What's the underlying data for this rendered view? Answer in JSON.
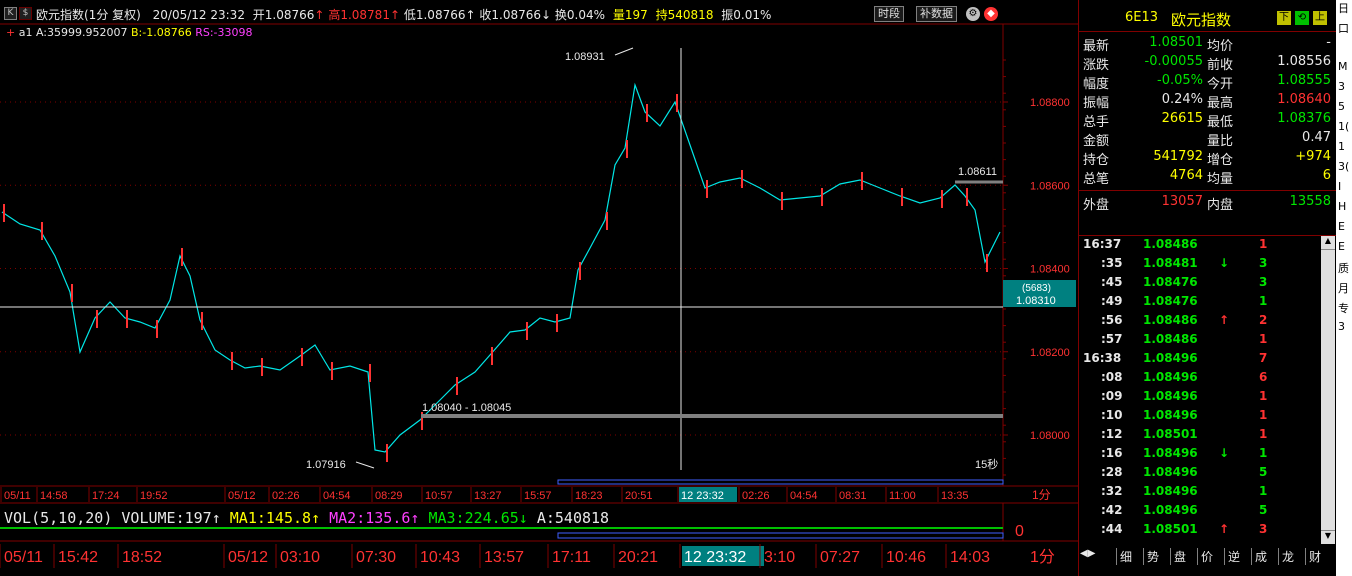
{
  "title_bar": {
    "k_label": "K",
    "dollar_label": "$",
    "name": "欧元指数(1分 复权)",
    "datetime": "20/05/12 23:32",
    "open_label": "开",
    "open": "1.08766",
    "high_label": "高",
    "high": "1.08781",
    "low_label": "低",
    "low": "1.08766",
    "close_label": "收",
    "close": "1.08766",
    "turnover_label": "换",
    "turnover": "0.04%",
    "volume_label": "量",
    "volume": "197",
    "hold_label": "持",
    "hold": "540818",
    "amplitude_label": "振",
    "amplitude": "0.01%",
    "btn_period": "时段",
    "btn_fill": "补数据"
  },
  "sub_bar": {
    "label": "a1",
    "a_text": "A:35999.952007",
    "b_text": "B:-1.08766",
    "rs_text": "RS:-33098"
  },
  "price_axis": [
    "1.08800",
    "1.08600",
    "1.08400",
    "1.08200",
    "1.08000"
  ],
  "cursor_box": {
    "vol": "(5683)",
    "price": "1.08310"
  },
  "annotations": {
    "high_mark": "1.08931",
    "low_mark": "1.07916",
    "line1": "1.08040 - 1.08045",
    "right_mark": "1.08611",
    "period_15s": "15秒"
  },
  "time_axis_top": [
    "05/11",
    "14:58",
    "17:24",
    "19:52",
    "05/12",
    "02:26",
    "04:54",
    "08:29",
    "10:57",
    "13:27",
    "15:57",
    "18:23",
    "20:51",
    "12 23:32",
    "02:26",
    "04:54",
    "08:31",
    "11:00",
    "13:35"
  ],
  "time_axis_top_period": "1分",
  "vol_bar": {
    "name": "VOL(5,10,20)",
    "volume": "VOLUME:197",
    "ma1": "MA1:145.8",
    "ma2": "MA2:135.6",
    "ma3": "MA3:224.65",
    "a": "A:540818",
    "zero": "0"
  },
  "time_axis_bottom": [
    "05/11",
    "15:42",
    "18:52",
    "05/12",
    "03:10",
    "07:30",
    "10:43",
    "13:57",
    "17:11",
    "20:21",
    "12 23:32",
    "3:10",
    "07:27",
    "10:46",
    "14:03"
  ],
  "time_axis_bottom_period": "1分",
  "right_panel": {
    "code": "6E13",
    "name": "欧元指数",
    "quotes": [
      {
        "l1": "最新",
        "v1": "1.08501",
        "c1": "green",
        "l2": "均价",
        "v2": "-",
        "c2": "white"
      },
      {
        "l1": "涨跌",
        "v1": "-0.00055",
        "c1": "green",
        "l2": "前收",
        "v2": "1.08556",
        "c2": "white"
      },
      {
        "l1": "幅度",
        "v1": "-0.05%",
        "c1": "green",
        "l2": "今开",
        "v2": "1.08555",
        "c2": "green"
      },
      {
        "l1": "振幅",
        "v1": "0.24%",
        "c1": "white",
        "l2": "最高",
        "v2": "1.08640",
        "c2": "red"
      },
      {
        "l1": "总手",
        "v1": "26615",
        "c1": "yellow",
        "l2": "最低",
        "v2": "1.08376",
        "c2": "green"
      },
      {
        "l1": "金额",
        "v1": "",
        "c1": "white",
        "l2": "量比",
        "v2": "0.47",
        "c2": "white"
      },
      {
        "l1": "持仓",
        "v1": "541792",
        "c1": "yellow",
        "l2": "增仓",
        "v2": "+974",
        "c2": "yellow"
      },
      {
        "l1": "总笔",
        "v1": "4764",
        "c1": "yellow",
        "l2": "均量",
        "v2": "6",
        "c2": "yellow"
      },
      {
        "l1": "外盘",
        "v1": "13057",
        "c1": "red",
        "l2": "内盘",
        "v2": "13558",
        "c2": "green"
      }
    ],
    "ticks": [
      {
        "t": "16:37",
        "p": "1.08486",
        "a": "",
        "ac": "green",
        "v": "1",
        "vc": "red"
      },
      {
        "t": ":35",
        "p": "1.08481",
        "a": "↓",
        "ac": "green",
        "v": "3",
        "vc": "green"
      },
      {
        "t": ":45",
        "p": "1.08476",
        "a": "",
        "ac": "green",
        "v": "3",
        "vc": "green"
      },
      {
        "t": ":49",
        "p": "1.08476",
        "a": "",
        "ac": "green",
        "v": "1",
        "vc": "green"
      },
      {
        "t": ":56",
        "p": "1.08486",
        "a": "↑",
        "ac": "red",
        "v": "2",
        "vc": "red"
      },
      {
        "t": ":57",
        "p": "1.08486",
        "a": "",
        "ac": "green",
        "v": "1",
        "vc": "red"
      },
      {
        "t": "16:38",
        "p": "1.08496",
        "a": "",
        "ac": "green",
        "v": "7",
        "vc": "red"
      },
      {
        "t": ":08",
        "p": "1.08496",
        "a": "",
        "ac": "green",
        "v": "6",
        "vc": "red"
      },
      {
        "t": ":09",
        "p": "1.08496",
        "a": "",
        "ac": "green",
        "v": "1",
        "vc": "red"
      },
      {
        "t": ":10",
        "p": "1.08496",
        "a": "",
        "ac": "green",
        "v": "1",
        "vc": "red"
      },
      {
        "t": ":12",
        "p": "1.08501",
        "a": "",
        "ac": "green",
        "v": "1",
        "vc": "red"
      },
      {
        "t": ":16",
        "p": "1.08496",
        "a": "↓",
        "ac": "green",
        "v": "1",
        "vc": "green"
      },
      {
        "t": ":28",
        "p": "1.08496",
        "a": "",
        "ac": "green",
        "v": "5",
        "vc": "green"
      },
      {
        "t": ":32",
        "p": "1.08496",
        "a": "",
        "ac": "green",
        "v": "1",
        "vc": "green"
      },
      {
        "t": ":42",
        "p": "1.08496",
        "a": "",
        "ac": "green",
        "v": "5",
        "vc": "green"
      },
      {
        "t": ":44",
        "p": "1.08501",
        "a": "↑",
        "ac": "red",
        "v": "3",
        "vc": "red"
      }
    ],
    "tabs": [
      "细",
      "势",
      "盘",
      "价",
      "逆",
      "成",
      "龙",
      "财"
    ]
  },
  "far_right": [
    "日",
    "口",
    "",
    "M",
    "3",
    "5",
    "1(",
    "1",
    "3(",
    "I",
    "H",
    "E",
    "E",
    "质",
    "月",
    "专",
    "3"
  ],
  "colors": {
    "up": "#ff3232",
    "down": "#00e6e6",
    "grid": "#800000",
    "axis_text": "#ff3232",
    "highlight": "#008080"
  }
}
